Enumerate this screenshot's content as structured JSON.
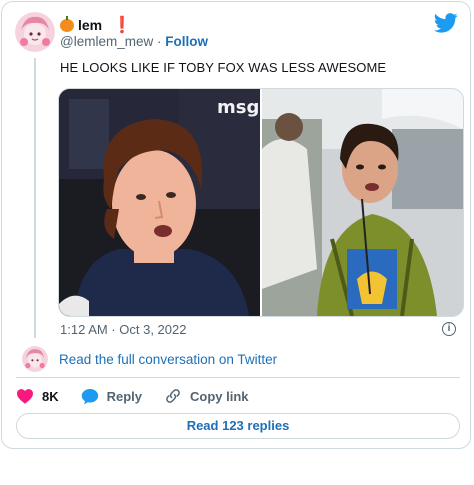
{
  "author": {
    "name": "lem",
    "emoji": "pumpkin",
    "badge": "❗",
    "handle": "@lemlem_mew",
    "separator": "·",
    "follow_label": "Follow"
  },
  "tweet": {
    "text": "HE LOOKS LIKE IF TOBY FOX WAS LESS AWESOME",
    "timestamp": "1:12 AM · Oct 3, 2022",
    "media_left_sign": "msg"
  },
  "links": {
    "read_full": "Read the full conversation on Twitter",
    "read_replies": "Read 123 replies"
  },
  "actions": {
    "likes": "8K",
    "reply": "Reply",
    "copy_link": "Copy link"
  },
  "colors": {
    "twitter_blue": "#1d9bf0",
    "link_blue": "#1d70b8",
    "heart": "#f91880",
    "muted": "#536471"
  }
}
